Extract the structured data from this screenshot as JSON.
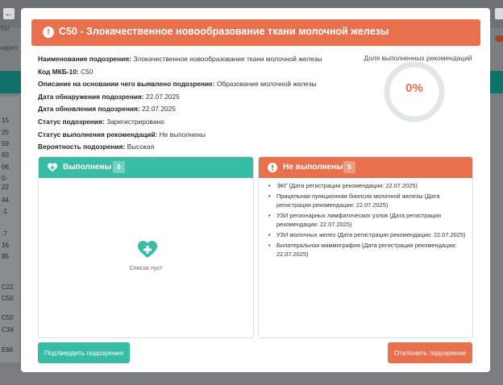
{
  "background": {
    "back_arrow": "←",
    "left_text": "Тат",
    "left_text2": "нкреп",
    "numbers": [
      "15",
      "25",
      "59",
      "83",
      "06",
      "0-",
      "22",
      "44",
      "-1",
      ".7",
      "16",
      "85",
      "C22",
      "C50",
      "C50",
      "C34",
      "E66"
    ]
  },
  "modal": {
    "alert_icon": "!",
    "title": "C50 - Злокачественное новообразование ткани молочной железы",
    "info": [
      {
        "label": "Наименование подозрения:",
        "value": "Злокачественное новообразование ткани молочной железы"
      },
      {
        "label": "Код МКБ-10:",
        "value": "C50"
      },
      {
        "label": "Описание на основании чего выявлено подозрение:",
        "value": "Образование молочной железы"
      },
      {
        "label": "Дата обнаружения подозрения:",
        "value": "22.07.2025"
      },
      {
        "label": "Дата обновления подозрения:",
        "value": "22.07.2025"
      },
      {
        "label": "Статус подозрения:",
        "value": "Зарегистрировано"
      },
      {
        "label": "Статус выполнения рекомендаций:",
        "value": "Не выполнены"
      },
      {
        "label": "Вероятность подозрения:",
        "value": "Высокая"
      }
    ],
    "progress": {
      "title": "Доля выполненных рекомендаций",
      "value_text": "0%",
      "value": 0
    },
    "completed": {
      "label": "Выполнены",
      "count": "0",
      "empty_text": "Список пуст"
    },
    "not_completed": {
      "label": "Не выполнены",
      "count": "5",
      "items": [
        "ЭКГ (Дата регистрации рекомендации: 22.07.2025)",
        "Прицельная пункционная биопсия молочной железы (Дата регистрации рекомендации: 22.07.2025)",
        "УЗИ регионарных лимфатических узлов (Дата регистрации рекомендации: 22.07.2025)",
        "УЗИ молочных желез (Дата регистрации рекомендации: 22.07.2025)",
        "Билатеральная маммография (Дата регистрации рекомендации: 22.07.2025)"
      ]
    },
    "buttons": {
      "confirm": "Подтвердить подозрение",
      "reject": "Отклонить подозрение"
    }
  },
  "colors": {
    "accent_orange": "#e8704d",
    "accent_teal": "#38bca6"
  }
}
